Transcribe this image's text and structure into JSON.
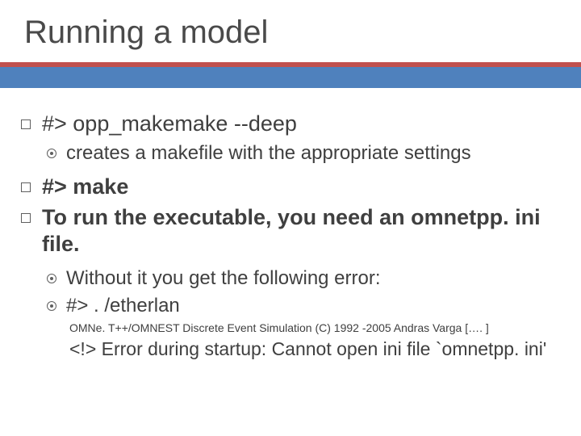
{
  "title": "Running a model",
  "items": [
    {
      "level": 1,
      "text": "#> opp_makemake --deep",
      "bold": false
    },
    {
      "level": 2,
      "text": "creates a makefile with the appropriate settings",
      "bold": false
    },
    {
      "level": 1,
      "text": "#> make",
      "bold": true
    },
    {
      "level": 1,
      "text": "To run the executable, you need an omnetpp. ini file.",
      "bold": true
    },
    {
      "level": 2,
      "text": "Without it you get the following error:",
      "bold": false
    },
    {
      "level": 2,
      "text": "#> . /etherlan",
      "bold": false
    }
  ],
  "footnote": "OMNe. T++/OMNEST Discrete Event Simulation (C) 1992 -2005 Andras Varga […. ]",
  "error_text": "<!> Error during startup: Cannot open ini file `omnetpp. ini'"
}
